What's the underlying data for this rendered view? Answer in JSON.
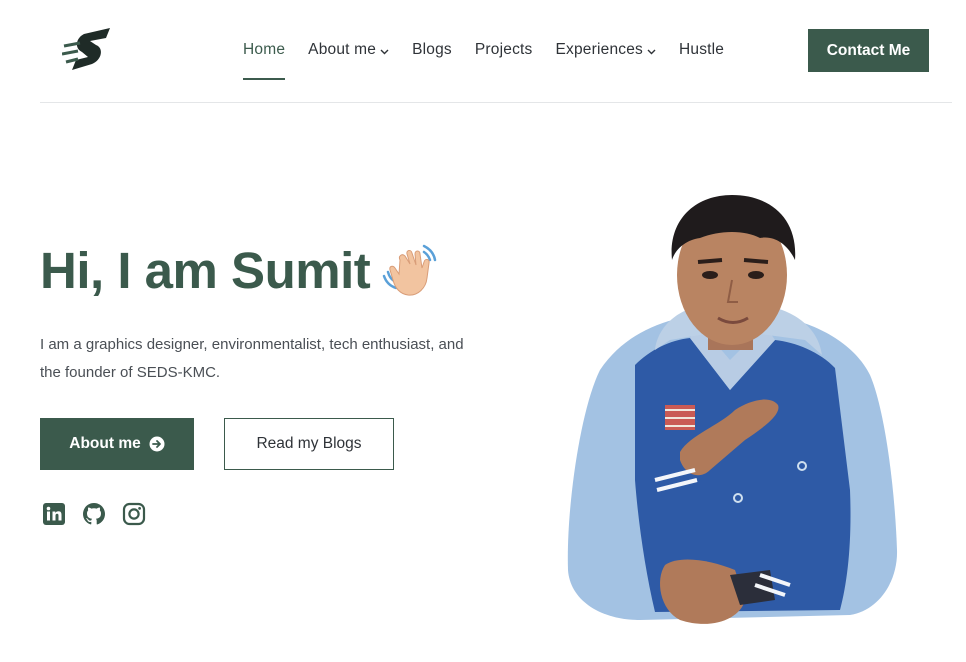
{
  "header": {
    "nav": [
      {
        "label": "Home",
        "active": true,
        "dropdown": false
      },
      {
        "label": "About me",
        "active": false,
        "dropdown": true
      },
      {
        "label": "Blogs",
        "active": false,
        "dropdown": false
      },
      {
        "label": "Projects",
        "active": false,
        "dropdown": false
      },
      {
        "label": "Experiences",
        "active": false,
        "dropdown": true
      },
      {
        "label": "Hustle",
        "active": false,
        "dropdown": false
      }
    ],
    "contact_label": "Contact Me"
  },
  "hero": {
    "title": "Hi, I am Sumit",
    "description": "I am a graphics designer, environmentalist, tech enthusiast, and the founder of SEDS-KMC.",
    "primary_button": "About me",
    "secondary_button": "Read my Blogs",
    "social_icons": [
      "linkedin-icon",
      "github-icon",
      "instagram-icon"
    ]
  },
  "colors": {
    "accent": "#3b5a4c",
    "text": "#2f3338",
    "divider": "#e4e6e8"
  }
}
